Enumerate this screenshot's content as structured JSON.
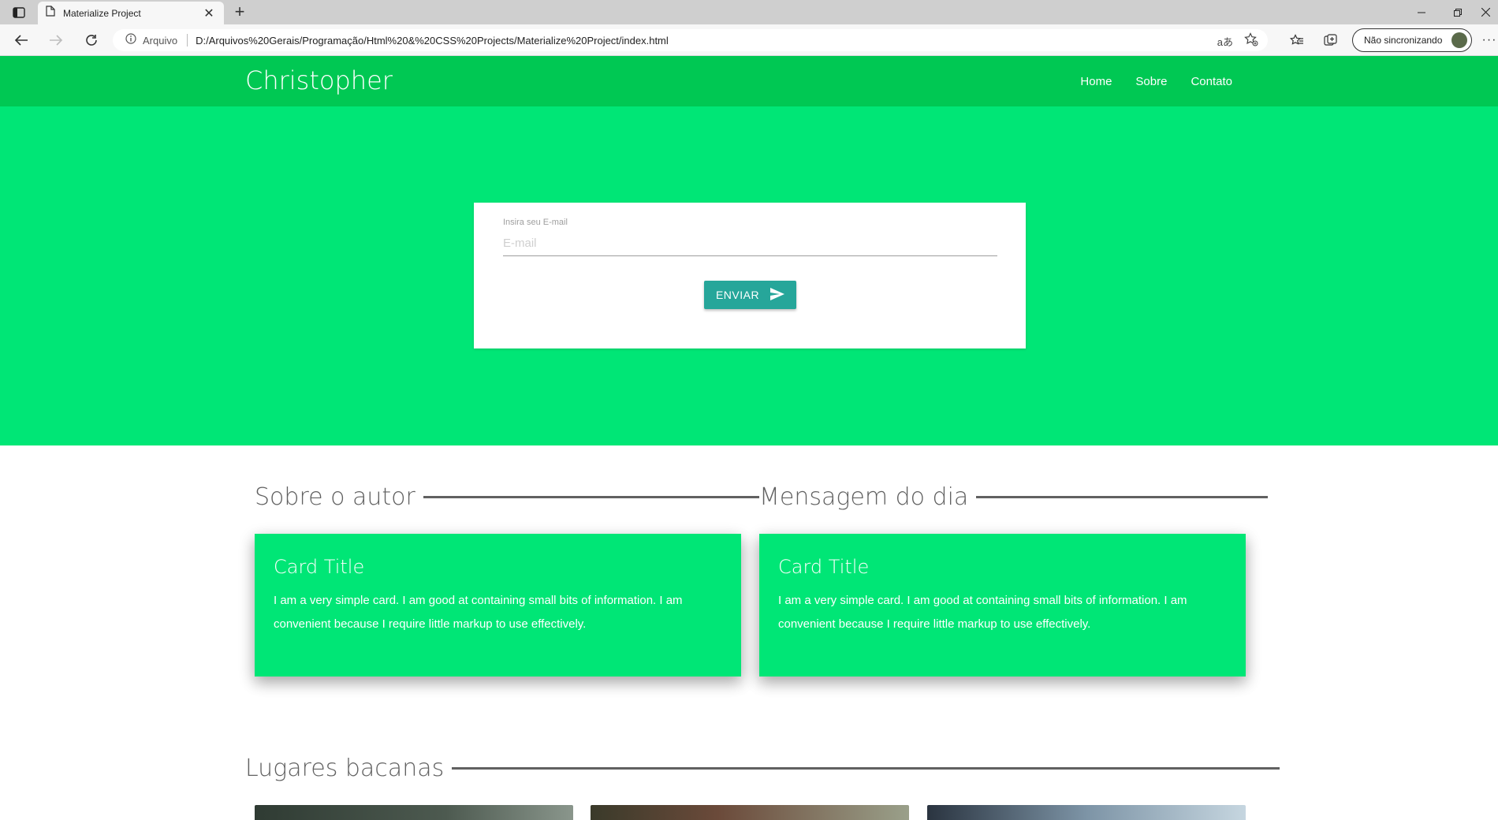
{
  "browser": {
    "tab_title": "Materialize Project",
    "new_tab_icon": "plus",
    "address": {
      "security_label": "Arquivo",
      "url": "D:/Arquivos%20Gerais/Programação/Html%20&%20CSS%20Projects/Materialize%20Project/index.html"
    },
    "sync_label": "Não sincronizando"
  },
  "navbar": {
    "brand": "Christopher",
    "links": [
      "Home",
      "Sobre",
      "Contato"
    ],
    "color": "#00c853"
  },
  "hero": {
    "color": "#00e676",
    "form": {
      "label": "Insira seu E-mail",
      "placeholder": "E-mail",
      "button_label": "ENVIAR",
      "button_color": "#26a69a"
    }
  },
  "sections": [
    {
      "title": "Sobre o autor",
      "card": {
        "title": "Card Title",
        "text": "I am a very simple card. I am good at containing small bits of information. I am convenient because I require little markup to use effectively."
      }
    },
    {
      "title": "Mensagem do dia",
      "card": {
        "title": "Card Title",
        "text": "I am a very simple card. I am good at containing small bits of information. I am convenient because I require little markup to use effectively."
      }
    }
  ],
  "places": {
    "title": "Lugares bacanas"
  }
}
